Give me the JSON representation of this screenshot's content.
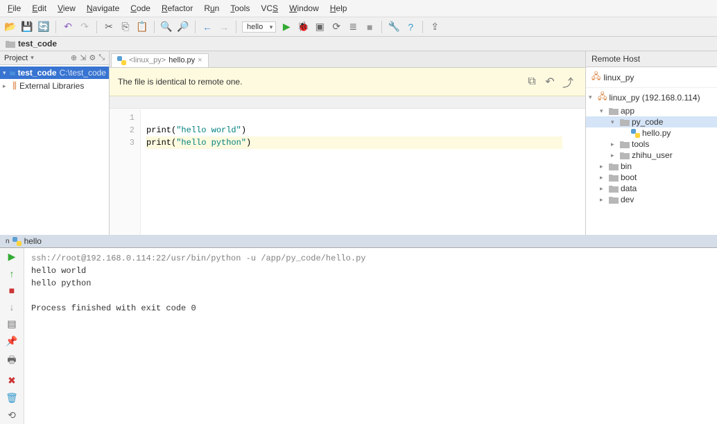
{
  "menubar": [
    "File",
    "Edit",
    "View",
    "Navigate",
    "Code",
    "Refactor",
    "Run",
    "Tools",
    "VCS",
    "Window",
    "Help"
  ],
  "run_config": "hello",
  "breadcrumb": {
    "project": "test_code"
  },
  "project_pane": {
    "title": "Project",
    "root": {
      "name": "test_code",
      "path": "C:\\test_code"
    },
    "ext_libs": "External Libraries"
  },
  "editor": {
    "tab_prefix": "<linux_py>",
    "tab_file": "hello.py",
    "notice": "The file is identical to remote one.",
    "lines": [
      {
        "n": "1",
        "text": ""
      },
      {
        "n": "2",
        "text_a": "print(",
        "str": "\"hello world\"",
        "text_b": ")"
      },
      {
        "n": "3",
        "text_a": "print(",
        "str": "\"hello python\"",
        "text_b": ")"
      }
    ]
  },
  "remote": {
    "title": "Remote Host",
    "conn": "linux_py",
    "root": "linux_py (192.168.0.114)",
    "tree": [
      {
        "depth": 1,
        "exp": "▾",
        "label": "app",
        "type": "folder"
      },
      {
        "depth": 2,
        "exp": "▾",
        "label": "py_code",
        "type": "folder",
        "selected": true
      },
      {
        "depth": 3,
        "exp": "",
        "label": "hello.py",
        "type": "py"
      },
      {
        "depth": 2,
        "exp": "▸",
        "label": "tools",
        "type": "folder"
      },
      {
        "depth": 2,
        "exp": "▸",
        "label": "zhihu_user",
        "type": "folder"
      },
      {
        "depth": 1,
        "exp": "▸",
        "label": "bin",
        "type": "folder"
      },
      {
        "depth": 1,
        "exp": "▸",
        "label": "boot",
        "type": "folder"
      },
      {
        "depth": 1,
        "exp": "▸",
        "label": "data",
        "type": "folder"
      },
      {
        "depth": 1,
        "exp": "▸",
        "label": "dev",
        "type": "folder"
      }
    ]
  },
  "run": {
    "tab": "hello",
    "cmd": "ssh://root@192.168.0.114:22/usr/bin/python -u /app/py_code/hello.py",
    "out1": "hello world",
    "out2": "hello python",
    "exit": "Process finished with exit code 0"
  }
}
